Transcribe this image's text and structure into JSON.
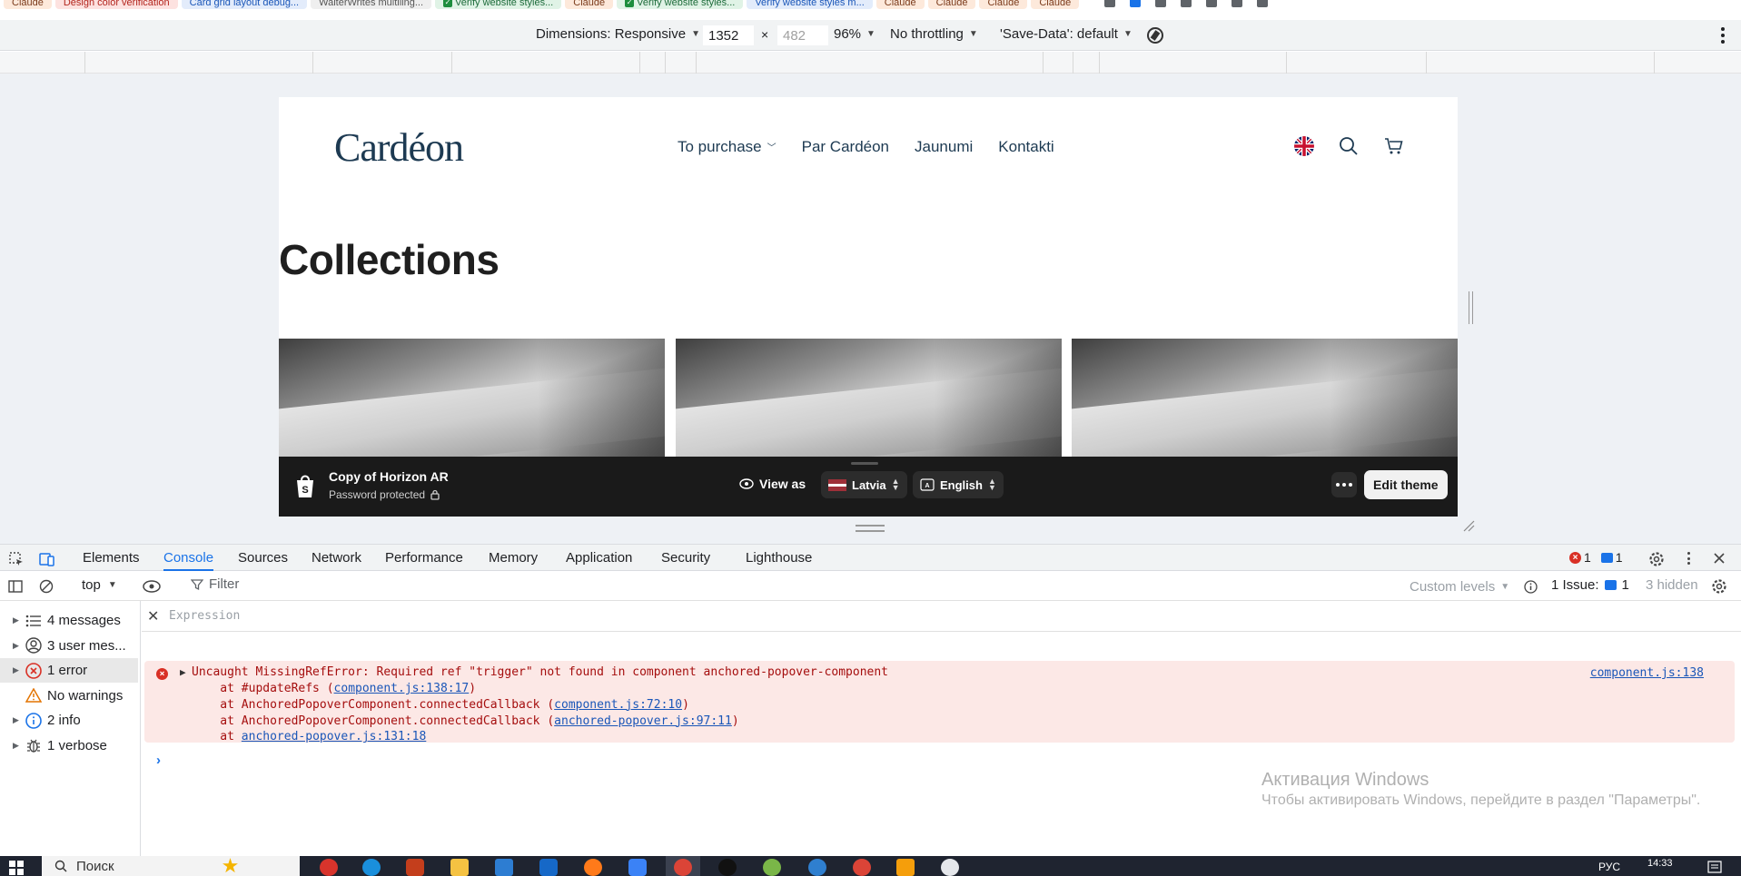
{
  "bookmarks": [
    {
      "label": "Claude",
      "style": "orange",
      "check": false
    },
    {
      "label": "Design color verification",
      "style": "red",
      "check": false
    },
    {
      "label": "Card grid layout debug...",
      "style": "blue",
      "check": false
    },
    {
      "label": "WalterWrites multiling...",
      "style": "grey",
      "check": false
    },
    {
      "label": "Verify website styles...",
      "style": "green",
      "check": true
    },
    {
      "label": "Claude",
      "style": "orange",
      "check": false
    },
    {
      "label": "Verify website styles...",
      "style": "green",
      "check": true
    },
    {
      "label": "Verify website styles m...",
      "style": "blue",
      "check": false
    },
    {
      "label": "Claude",
      "style": "orange",
      "check": false
    },
    {
      "label": "Claude",
      "style": "orange",
      "check": false
    },
    {
      "label": "Claude",
      "style": "orange",
      "check": false
    },
    {
      "label": "Claude",
      "style": "orange",
      "check": false
    }
  ],
  "device_toolbar": {
    "dimensions_label": "Dimensions: Responsive",
    "width_value": "1352",
    "times": "×",
    "height_value": "482",
    "zoom": "96%",
    "throttling": "No throttling",
    "save_data": "'Save-Data': default"
  },
  "site": {
    "logo": "Cardéon",
    "nav": [
      {
        "label": "To purchase",
        "has_dropdown": true
      },
      {
        "label": "Par Cardéon",
        "has_dropdown": false
      },
      {
        "label": "Jaunumi",
        "has_dropdown": false
      },
      {
        "label": "Kontakti",
        "has_dropdown": false
      }
    ],
    "icons": [
      "uk-flag-icon",
      "search-icon",
      "cart-icon"
    ],
    "page_title": "Collections",
    "card_count": 3
  },
  "preview_bar": {
    "theme_name": "Copy of Horizon AR",
    "status": "Password protected",
    "view_as": "View as",
    "country": "Latvia",
    "language": "English",
    "edit_button": "Edit theme"
  },
  "devtools": {
    "tabs": [
      "Elements",
      "Console",
      "Sources",
      "Network",
      "Performance",
      "Memory",
      "Application",
      "Security",
      "Lighthouse"
    ],
    "active_tab": "Console",
    "error_count": "1",
    "issue_badge_count": "1",
    "context": "top",
    "filter_placeholder": "Filter",
    "custom_levels": "Custom levels",
    "issues_label": "1 Issue:",
    "issues_count": "1",
    "hidden": "3 hidden",
    "sidebar": [
      {
        "label": "4 messages",
        "icon": "list-icon",
        "selected": false
      },
      {
        "label": "3 user mes...",
        "icon": "user-icon",
        "selected": false
      },
      {
        "label": "1 error",
        "icon": "error-icon",
        "selected": true
      },
      {
        "label": "No warnings",
        "icon": "warning-icon",
        "selected": false
      },
      {
        "label": "2 info",
        "icon": "info-icon",
        "selected": false
      },
      {
        "label": "1 verbose",
        "icon": "bug-icon",
        "selected": false
      }
    ],
    "expression_placeholder": "Expression",
    "error": {
      "message": "Uncaught MissingRefError: Required ref \"trigger\" not found in component anchored-popover-component",
      "source": "component.js:138",
      "stack": [
        {
          "prefix": "    at #updateRefs (",
          "link": "component.js:138:17",
          "suffix": ")"
        },
        {
          "prefix": "    at AnchoredPopoverComponent.connectedCallback (",
          "link": "component.js:72:10",
          "suffix": ")"
        },
        {
          "prefix": "    at AnchoredPopoverComponent.connectedCallback (",
          "link": "anchored-popover.js:97:11",
          "suffix": ")"
        },
        {
          "prefix": "    at ",
          "link": "anchored-popover.js:131:18",
          "suffix": ""
        }
      ]
    },
    "watermark_title": "Активация Windows",
    "watermark_sub": "Чтобы активировать Windows, перейдите в раздел \"Параметры\"."
  },
  "taskbar": {
    "search_placeholder": "Поиск",
    "lang": "РУС",
    "time": "14:33"
  }
}
